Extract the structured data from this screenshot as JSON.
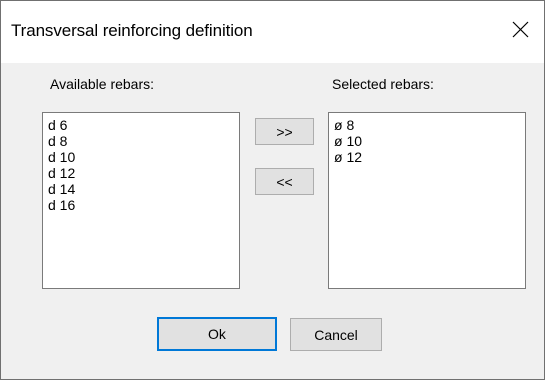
{
  "dialog": {
    "title": "Transversal reinforcing definition",
    "close_icon": "close-icon"
  },
  "available": {
    "label": "Available rebars:",
    "items": [
      "d 6",
      "d 8",
      "d 10",
      "d 12",
      "d 14",
      "d 16"
    ]
  },
  "selected": {
    "label": "Selected rebars:",
    "items": [
      "ø 8",
      "ø 10",
      "ø 12"
    ]
  },
  "buttons": {
    "add_label": ">>",
    "remove_label": "<<",
    "ok_label": "Ok",
    "cancel_label": "Cancel"
  },
  "colors": {
    "default_button_border": "#0078d7",
    "button_face": "#e1e1e1",
    "dialog_background": "#f0f0f0"
  }
}
